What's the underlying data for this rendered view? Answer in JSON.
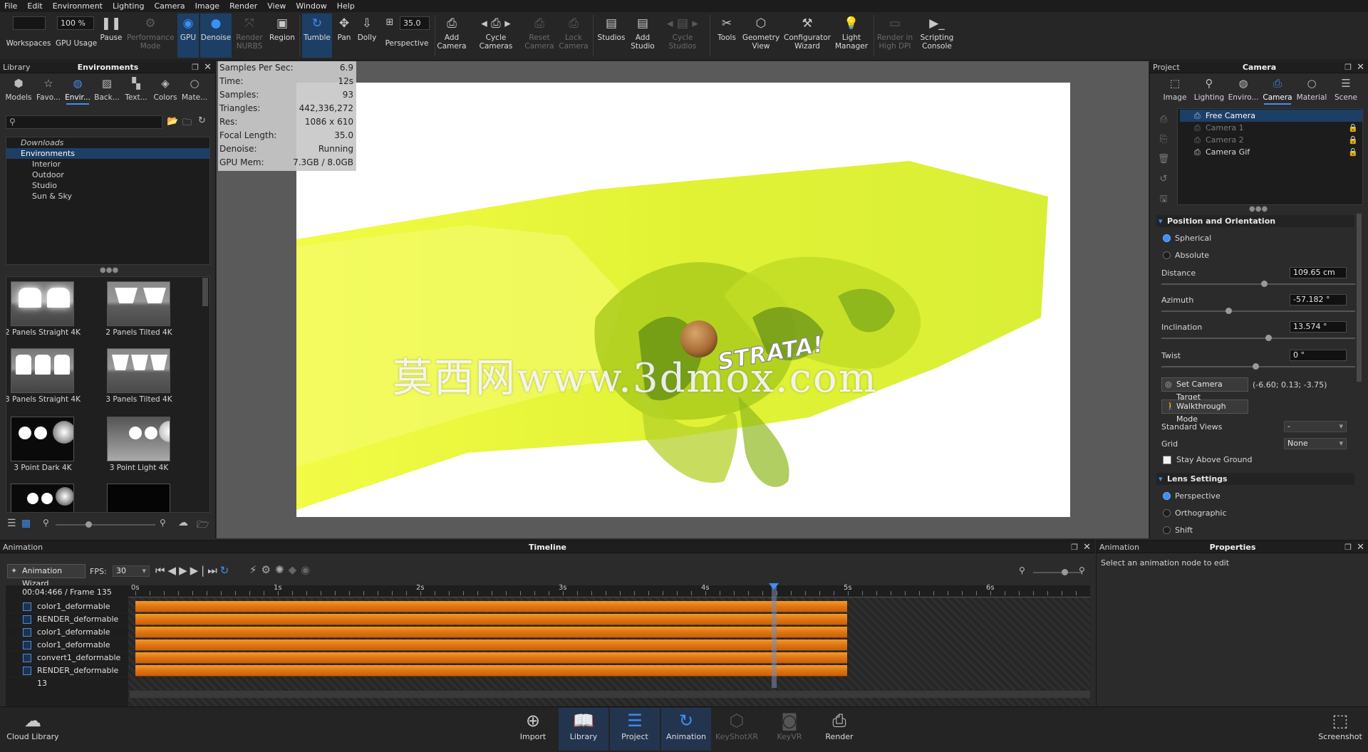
{
  "menu": [
    "File",
    "Edit",
    "Environment",
    "Lighting",
    "Camera",
    "Image",
    "Render",
    "View",
    "Window",
    "Help"
  ],
  "ribbon": {
    "workspaces": "Workspaces",
    "gpu_usage_value": "100 %",
    "gpu_usage": "GPU Usage",
    "pause": "Pause",
    "performance_mode": "Performance Mode",
    "gpu": "GPU",
    "denoise": "Denoise",
    "render_nurbs": "Render NURBS",
    "region": "Region",
    "tumble": "Tumble",
    "pan": "Pan",
    "dolly": "Dolly",
    "perspective_value": "35.0",
    "perspective": "Perspective",
    "add_camera": "Add Camera",
    "cycle_cameras": "Cycle Cameras",
    "reset_camera": "Reset Camera",
    "lock_camera": "Lock Camera",
    "studios": "Studios",
    "add_studio": "Add Studio",
    "cycle_studios": "Cycle Studios",
    "tools": "Tools",
    "geometry_view": "Geometry View",
    "configurator_wizard": "Configurator Wizard",
    "light_manager": "Light Manager",
    "render_high_dpi": "Render in High DPI",
    "scripting_console": "Scripting Console"
  },
  "library": {
    "header_left": "Library",
    "title": "Environments",
    "tabs": [
      "Models",
      "Favo...",
      "Envir...",
      "Back...",
      "Text...",
      "Colors",
      "Mate..."
    ],
    "tree": [
      "Downloads",
      "Environments",
      "Interior",
      "Outdoor",
      "Studio",
      "Sun & Sky"
    ],
    "thumbs": [
      "2 Panels Straight 4K",
      "2 Panels Tilted 4K",
      "3 Panels Straight 4K",
      "3 Panels Tilted 4K",
      "3 Point Dark 4K",
      "3 Point Light 4K"
    ]
  },
  "stats": [
    {
      "k": "Samples Per Sec:",
      "v": "6.9"
    },
    {
      "k": "Time:",
      "v": "12s"
    },
    {
      "k": "Samples:",
      "v": "93"
    },
    {
      "k": "Triangles:",
      "v": "442,336,272"
    },
    {
      "k": "Res:",
      "v": "1086 x 610"
    },
    {
      "k": "Focal Length:",
      "v": "35.0"
    },
    {
      "k": "Denoise:",
      "v": "Running"
    },
    {
      "k": "GPU Mem:",
      "v": "7.3GB / 8.0GB"
    }
  ],
  "viewport": {
    "logo_text": "STRATA!",
    "watermark": "莫西网www.3dmox.com"
  },
  "project": {
    "header_left": "Project",
    "title": "Camera",
    "tabs": [
      "Image",
      "Lighting",
      "Enviro...",
      "Camera",
      "Material",
      "Scene"
    ],
    "cameras": [
      "Free Camera",
      "Camera 1",
      "Camera 2",
      "Camera Gif"
    ],
    "pos_section": "Position and Orientation",
    "spherical": "Spherical",
    "absolute": "Absolute",
    "distance_label": "Distance",
    "distance_value": "109.65 cm",
    "azimuth_label": "Azimuth",
    "azimuth_value": "-57.182 °",
    "inclination_label": "Inclination",
    "inclination_value": "13.574 °",
    "twist_label": "Twist",
    "twist_value": "0 °",
    "set_target": "Set Camera Target",
    "target_coords": "(-6.60; 0.13; -3.75)",
    "walkthrough": "Walkthrough Mode",
    "standard_views_label": "Standard Views",
    "standard_views_value": "-",
    "grid_label": "Grid",
    "grid_value": "None",
    "stay_above": "Stay Above Ground",
    "lens_section": "Lens Settings",
    "perspective": "Perspective",
    "orthographic": "Orthographic",
    "shift": "Shift"
  },
  "animation": {
    "header_left": "Animation",
    "title": "Timeline",
    "wizard": "Animation Wizard",
    "fps_label": "FPS:",
    "fps_value": "30",
    "time": "00:04:466 / Frame 135",
    "ticks": [
      "0s",
      "1s",
      "2s",
      "3s",
      "4s",
      "5s",
      "6s"
    ],
    "tracks": [
      "color1_deformable",
      "RENDER_deformable",
      "color1_deformable",
      "color1_deformable",
      "convert1_deformable",
      "RENDER_deformable 13"
    ]
  },
  "properties": {
    "header_left": "Animation",
    "title": "Properties",
    "hint": "Select an animation node to edit"
  },
  "bottom": {
    "cloud_library": "Cloud Library",
    "import": "Import",
    "library": "Library",
    "project": "Project",
    "animation": "Animation",
    "keyshotxr": "KeyShotXR",
    "keyvr": "KeyVR",
    "render": "Render",
    "screenshot": "Screenshot"
  }
}
